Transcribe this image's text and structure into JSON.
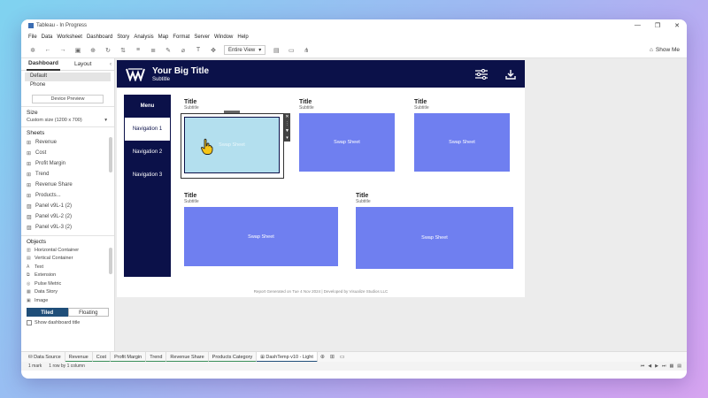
{
  "window": {
    "title": "Tableau - In Progress",
    "controls": [
      "—",
      "❐",
      "✕"
    ]
  },
  "menubar": [
    "File",
    "Data",
    "Worksheet",
    "Dashboard",
    "Story",
    "Analysis",
    "Map",
    "Format",
    "Server",
    "Window",
    "Help"
  ],
  "toolbar": {
    "fit_value": "Entire View",
    "show_me": "Show Me"
  },
  "left_panel": {
    "tabs": [
      "Dashboard",
      "Layout"
    ],
    "devices": [
      "Default",
      "Phone"
    ],
    "device_preview": "Device Preview",
    "size_title": "Size",
    "size_value": "Custom size (1200 x 700)",
    "sheets_title": "Sheets",
    "sheets": [
      "Revenue",
      "Cost",
      "Profit Margin",
      "Trend",
      "Revenue Share",
      "Products...",
      "Panel v9L-1 (2)",
      "Panel v9L-2 (2)",
      "Panel v9L-3 (2)"
    ],
    "objects_title": "Objects",
    "objects": [
      "Horizontal Container",
      "Vertical Container",
      "Text",
      "Extension",
      "Pulse Metric",
      "Data Story",
      "Image"
    ],
    "tiled": "Tiled",
    "floating": "Floating",
    "show_dashboard_title": "Show dashboard title"
  },
  "dashboard": {
    "title": "Your Big Title",
    "subtitle": "Subtitle",
    "menu_label": "Menu",
    "nav": [
      "Navigation 1",
      "Navigation 2",
      "Navigation 3"
    ],
    "cards": [
      {
        "title": "Title",
        "subtitle": "Subtitle",
        "content": "Swap Sheet"
      },
      {
        "title": "Title",
        "subtitle": "Subtitle",
        "content": "Swap Sheet"
      },
      {
        "title": "Title",
        "subtitle": "Subtitle",
        "content": "Swap Sheet"
      },
      {
        "title": "Title",
        "subtitle": "Subtitle",
        "content": "Swap Sheet"
      },
      {
        "title": "Title",
        "subtitle": "Subtitle",
        "content": "Swap Sheet"
      }
    ],
    "footer": "Report Generated on Tue 4 Nov 2024 | Developed by Visualize Studios LLC"
  },
  "bottom_tabs": {
    "data_source": "Data Source",
    "sheets": [
      "Revenue",
      "Cost",
      "Profit Margin",
      "Trend",
      "Revenue Share",
      "Products Category"
    ],
    "active": "DashTemp v10 - Light"
  },
  "status": {
    "marks": "1 mark",
    "rows": "1 row by 1 column"
  },
  "colors": {
    "navy": "#0b1149",
    "swap_blue": "#6f7ff0",
    "selected_fill": "#b3dfee"
  }
}
